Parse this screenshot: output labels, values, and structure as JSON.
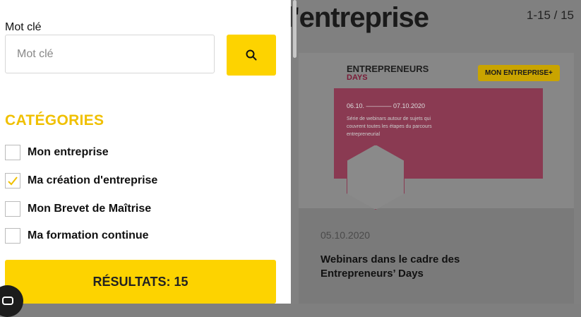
{
  "page": {
    "title": "l'entreprise",
    "pager": "1-15 / 15"
  },
  "card": {
    "event_name": "ENTREPRENEURS",
    "event_sub": "DAYS",
    "badge": "MON ENTREPRISE+",
    "dates": "06.10. ———— 07.10.2020",
    "desc": "Série de webinars autour de sujets qui couvrent toutes les étapes du parcours entrepreneurial",
    "date": "05.10.2020",
    "title": "Webinars dans le cadre des Entrepreneurs’ Days"
  },
  "filters": {
    "keyword_label": "Mot clé",
    "keyword_placeholder": "Mot clé",
    "keyword_value": "",
    "categories_title": "CATÉGORIES",
    "categories": [
      {
        "label": "Mon entreprise",
        "checked": false
      },
      {
        "label": "Ma création d'entreprise",
        "checked": true
      },
      {
        "label": "Mon Brevet de Maîtrise",
        "checked": false
      },
      {
        "label": "Ma formation continue",
        "checked": false
      }
    ],
    "results_label": "RÉSULTATS:",
    "results_count": "15"
  },
  "colors": {
    "accent": "#fdd300",
    "category_title": "#f0c000",
    "check": "#f0c000"
  },
  "icons": {
    "search": "search-icon",
    "check": "check-icon",
    "chat": "chat-icon"
  }
}
